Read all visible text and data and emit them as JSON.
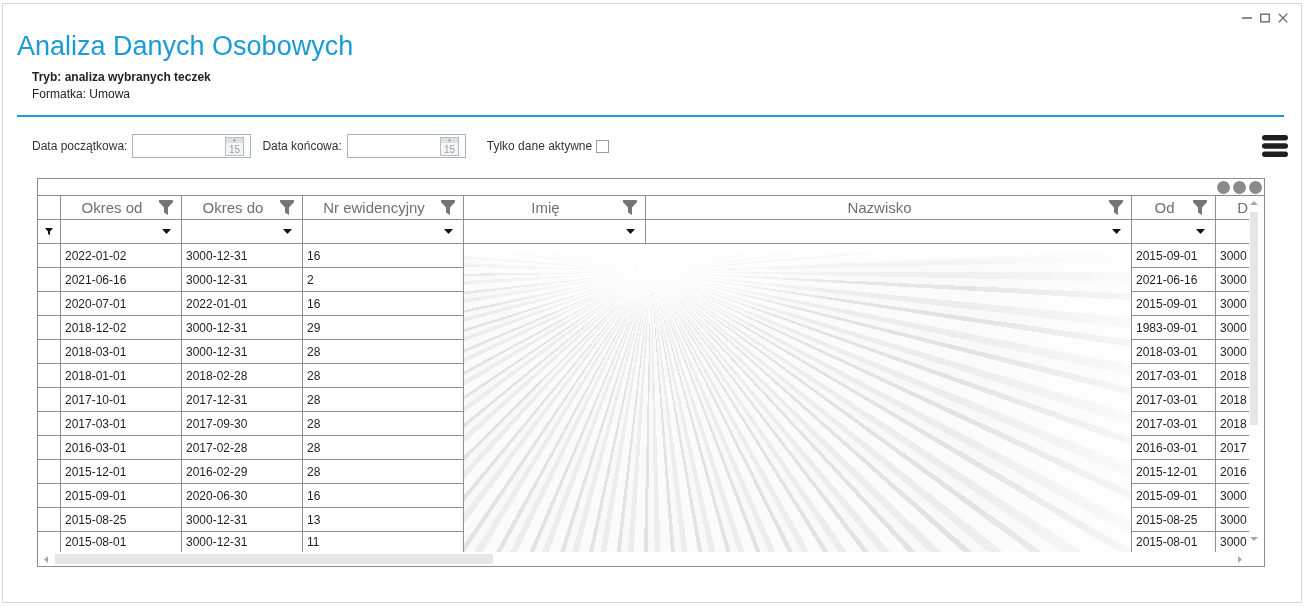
{
  "header": {
    "title": "Analiza Danych Osobowych",
    "mode": "Tryb: analiza wybranych teczek",
    "form": "Formatka: Umowa"
  },
  "filters": {
    "date_from": {
      "label": "Data początkowa:",
      "calendar_day": "15"
    },
    "date_to": {
      "label": "Data końcowa:",
      "calendar_day": "15"
    },
    "active_only": {
      "label": "Tylko dane aktywne",
      "checked": false
    }
  },
  "grid": {
    "columns": [
      {
        "label": "Okres od",
        "filter": true,
        "obscured": false
      },
      {
        "label": "Okres do",
        "filter": true,
        "obscured": false
      },
      {
        "label": "Nr ewidencyjny",
        "filter": true,
        "obscured": false
      },
      {
        "label": "Imię",
        "filter": true,
        "obscured": true
      },
      {
        "label": "Nazwisko",
        "filter": true,
        "obscured": true
      },
      {
        "label": "Od",
        "filter": true,
        "obscured": false
      },
      {
        "label": "D",
        "filter": false,
        "obscured": false
      }
    ],
    "rows": [
      [
        "2022-01-02",
        "3000-12-31",
        "16",
        "2015-09-01",
        "3000"
      ],
      [
        "2021-06-16",
        "3000-12-31",
        "2",
        "2021-06-16",
        "3000"
      ],
      [
        "2020-07-01",
        "2022-01-01",
        "16",
        "2015-09-01",
        "3000"
      ],
      [
        "2018-12-02",
        "3000-12-31",
        "29",
        "1983-09-01",
        "3000"
      ],
      [
        "2018-03-01",
        "3000-12-31",
        "28",
        "2018-03-01",
        "3000"
      ],
      [
        "2018-01-01",
        "2018-02-28",
        "28",
        "2017-03-01",
        "2018"
      ],
      [
        "2017-10-01",
        "2017-12-31",
        "28",
        "2017-03-01",
        "2018"
      ],
      [
        "2017-03-01",
        "2017-09-30",
        "28",
        "2017-03-01",
        "2018"
      ],
      [
        "2016-03-01",
        "2017-02-28",
        "28",
        "2016-03-01",
        "2017"
      ],
      [
        "2015-12-01",
        "2016-02-29",
        "28",
        "2015-12-01",
        "2016"
      ],
      [
        "2015-09-01",
        "2020-06-30",
        "16",
        "2015-09-01",
        "3000"
      ],
      [
        "2015-08-25",
        "3000-12-31",
        "13",
        "2015-08-25",
        "3000"
      ],
      [
        "2015-08-01",
        "3000-12-31",
        "11",
        "2015-08-01",
        "3000"
      ]
    ]
  }
}
